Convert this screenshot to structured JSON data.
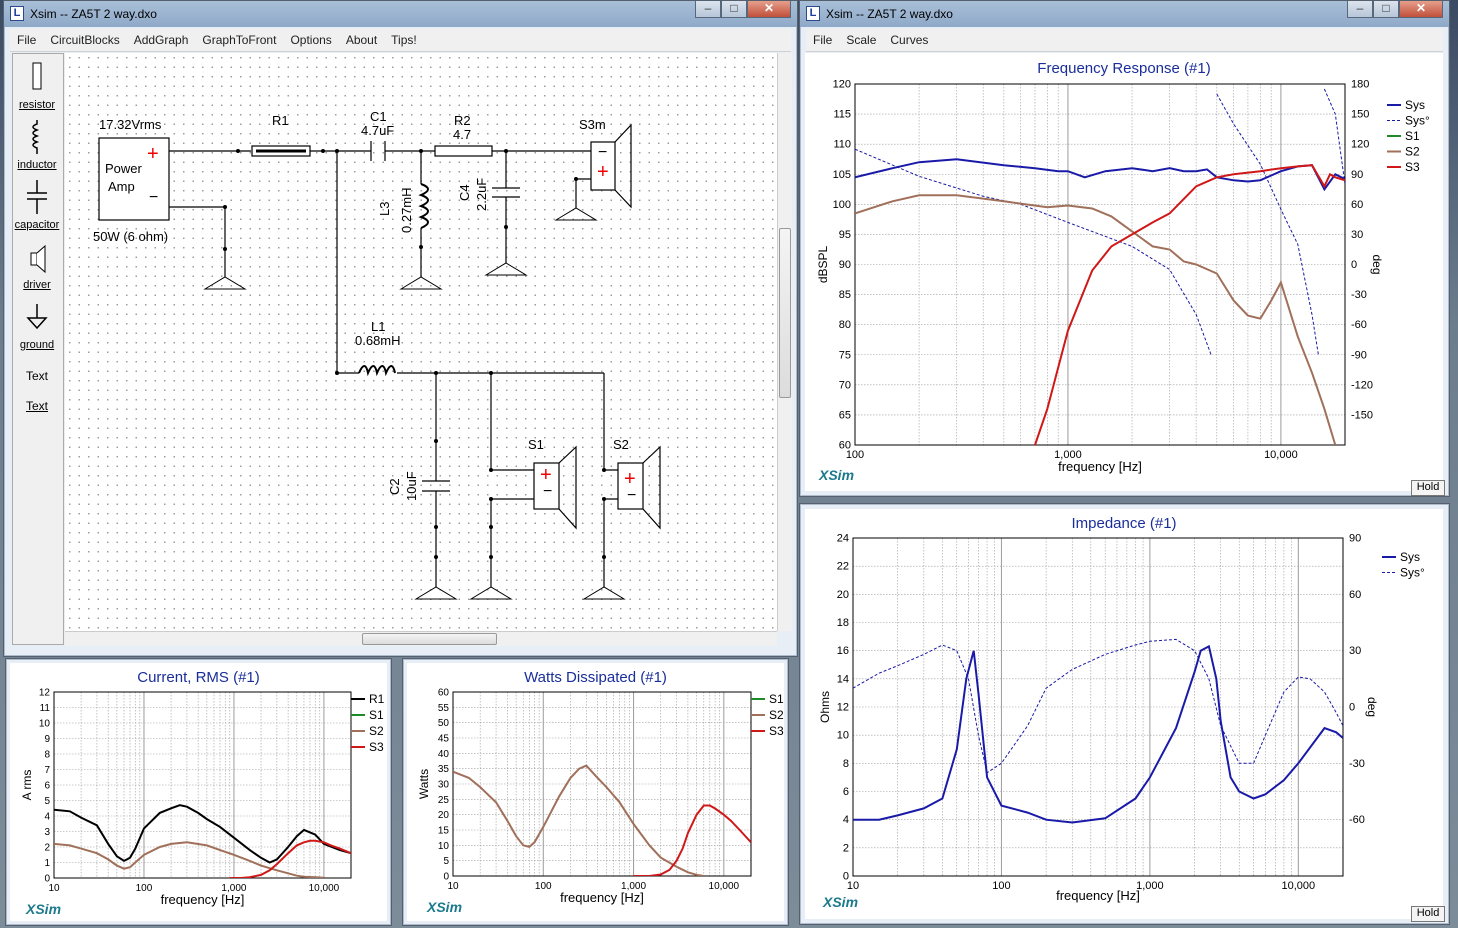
{
  "schematic_window": {
    "title": "Xsim -- ZA5T 2 way.dxo",
    "menu": [
      "File",
      "CircuitBlocks",
      "AddGraph",
      "GraphToFront",
      "Options",
      "About",
      "Tips!"
    ],
    "palette": [
      "resistor",
      "inductor",
      "capacitor",
      "driver",
      "ground",
      "Text",
      "Text"
    ],
    "components": {
      "voltage": "17.32Vrms",
      "amp_line1": "Power",
      "amp_line2": "Amp",
      "amp_rating": "50W (6 ohm)",
      "r1": "R1",
      "c1": "C1",
      "c1_val": "4.7uF",
      "r2": "R2",
      "r2_val": "4.7",
      "s3m": "S3m",
      "l3": "L3",
      "l3_val": "0.27mH",
      "c4": "C4",
      "c4_val": "2.2uF",
      "l1": "L1",
      "l1_val": "0.68mH",
      "c2": "C2",
      "c2_val": "10uF",
      "s1": "S1",
      "s2": "S2",
      "plus": "+",
      "minus": "−"
    }
  },
  "freq_window": {
    "title": "Xsim -- ZA5T 2 way.dxo",
    "menu": [
      "File",
      "Scale",
      "Curves"
    ],
    "graph_title": "Frequency Response (#1)",
    "ylabel": "dBSPL",
    "y2label": "deg",
    "xlabel": "frequency [Hz]",
    "xticks": [
      "100",
      "1,000",
      "10,000"
    ],
    "yticks": [
      "60",
      "65",
      "70",
      "75",
      "80",
      "85",
      "90",
      "95",
      "100",
      "105",
      "110",
      "115",
      "120"
    ],
    "y2ticks": [
      "-150",
      "-120",
      "-90",
      "-60",
      "-30",
      "0",
      "30",
      "60",
      "90",
      "120",
      "150",
      "180"
    ],
    "legend": [
      "Sys",
      "Sys°",
      "S1",
      "S2",
      "S3"
    ],
    "brand": "XSim",
    "hold": "Hold"
  },
  "impedance_window": {
    "graph_title": "Impedance (#1)",
    "ylabel": "Ohms",
    "y2label": "deg",
    "xlabel": "frequency [Hz]",
    "xticks": [
      "10",
      "100",
      "1,000",
      "10,000"
    ],
    "yticks": [
      "0",
      "2",
      "4",
      "6",
      "8",
      "10",
      "12",
      "14",
      "16",
      "18",
      "20",
      "22",
      "24"
    ],
    "y2ticks": [
      "-60",
      "-30",
      "0",
      "30",
      "60",
      "90"
    ],
    "legend": [
      "Sys",
      "Sys°"
    ],
    "brand": "XSim",
    "hold": "Hold"
  },
  "current_window": {
    "graph_title": "Current, RMS (#1)",
    "ylabel": "A rms",
    "xlabel": "frequency [Hz]",
    "xticks": [
      "10",
      "100",
      "1,000",
      "10,000"
    ],
    "yticks": [
      "0",
      "1",
      "2",
      "3",
      "4",
      "5",
      "6",
      "7",
      "8",
      "9",
      "10",
      "11",
      "12"
    ],
    "legend": [
      "R1",
      "S1",
      "S2",
      "S3"
    ],
    "brand": "XSim"
  },
  "watts_window": {
    "graph_title": "Watts Dissipated (#1)",
    "ylabel": "Watts",
    "xlabel": "frequency [Hz]",
    "xticks": [
      "10",
      "100",
      "1,000",
      "10,000"
    ],
    "yticks": [
      "0",
      "5",
      "10",
      "15",
      "20",
      "25",
      "30",
      "35",
      "40",
      "45",
      "50",
      "55",
      "60"
    ],
    "legend": [
      "S1",
      "S2",
      "S3"
    ],
    "brand": "XSim"
  },
  "colors": {
    "sys": "#1a1aa8",
    "s1": "#1e8a2a",
    "s2": "#a0705a",
    "s3": "#d01818",
    "r1": "#000000",
    "grid": "#9c9c9c",
    "title": "#1a2e9a"
  },
  "chart_data": [
    {
      "type": "line",
      "title": "Frequency Response (#1)",
      "xlabel": "frequency [Hz]",
      "ylabel": "dBSPL",
      "y2label": "deg",
      "xscale": "log",
      "xlim": [
        100,
        20000
      ],
      "ylim": [
        60,
        120
      ],
      "y2lim": [
        -180,
        180
      ],
      "legend_position": "top-right",
      "grid": true,
      "series": [
        {
          "name": "Sys",
          "axis": "y",
          "x": [
            100,
            150,
            200,
            300,
            500,
            700,
            900,
            1000,
            1200,
            1500,
            2000,
            2500,
            3000,
            3500,
            4000,
            4500,
            5000,
            6000,
            7000,
            8000,
            9000,
            10000,
            12000,
            14000,
            16000,
            18000,
            20000
          ],
          "y": [
            104.5,
            106,
            107,
            107.5,
            106.5,
            106,
            105.5,
            105.5,
            104.5,
            105.5,
            106,
            105.5,
            106,
            105.5,
            105.5,
            105.8,
            104.5,
            104,
            103.8,
            104,
            104.8,
            105.5,
            106.3,
            106.5,
            102.5,
            105,
            104.2
          ]
        },
        {
          "name": "Sys°",
          "axis": "y2",
          "x": [
            100,
            200,
            400,
            600,
            1000,
            1500,
            2000,
            3000,
            4000,
            4700,
            5000,
            6000,
            8000,
            10000,
            12000,
            14000,
            15000,
            16000,
            18000,
            20000
          ],
          "y": [
            115,
            88,
            68,
            60,
            42,
            28,
            18,
            -5,
            -50,
            -90,
            170,
            140,
            100,
            55,
            20,
            -50,
            -90,
            175,
            150,
            80
          ]
        },
        {
          "name": "S2",
          "axis": "y",
          "x": [
            100,
            150,
            200,
            300,
            500,
            800,
            1000,
            1300,
            1600,
            2000,
            2500,
            3000,
            3500,
            4000,
            5000,
            6000,
            7000,
            8000,
            9000,
            10000,
            12000,
            14000,
            16000,
            18000
          ],
          "y": [
            98.5,
            100.5,
            101.5,
            101.5,
            100.5,
            99.5,
            99.8,
            99.3,
            98,
            95.5,
            93,
            92.5,
            90.5,
            90,
            88.5,
            84,
            81.5,
            81,
            84,
            87,
            78,
            72,
            66,
            60
          ]
        },
        {
          "name": "S3",
          "axis": "y",
          "x": [
            700,
            800,
            1000,
            1300,
            1600,
            2000,
            2500,
            3000,
            4000,
            5000,
            6000,
            8000,
            10000,
            12000,
            14000,
            16000,
            17000,
            18000,
            20000
          ],
          "y": [
            60,
            66,
            79,
            89,
            93,
            95,
            97,
            98.5,
            103,
            104.5,
            105,
            105.5,
            106,
            106.3,
            106.5,
            103,
            105,
            104.5,
            104
          ]
        }
      ]
    },
    {
      "type": "line",
      "title": "Impedance (#1)",
      "xlabel": "frequency [Hz]",
      "ylabel": "Ohms",
      "y2label": "deg",
      "xscale": "log",
      "xlim": [
        10,
        20000
      ],
      "ylim": [
        0,
        24
      ],
      "y2lim": [
        -90,
        90
      ],
      "legend_position": "top-right",
      "grid": true,
      "series": [
        {
          "name": "Sys",
          "axis": "y",
          "x": [
            10,
            15,
            20,
            30,
            40,
            50,
            58,
            65,
            70,
            80,
            100,
            150,
            200,
            300,
            500,
            800,
            1000,
            1500,
            2000,
            2200,
            2500,
            2800,
            3000,
            3500,
            4000,
            5000,
            6000,
            8000,
            10000,
            15000,
            18000,
            20000
          ],
          "y": [
            4,
            4,
            4.3,
            4.8,
            5.5,
            9,
            14,
            16,
            13,
            7,
            5,
            4.5,
            4,
            3.8,
            4.1,
            5.5,
            7,
            10.5,
            14.5,
            16,
            16.3,
            14,
            11,
            7,
            6,
            5.5,
            5.8,
            6.8,
            8,
            10.5,
            10.2,
            9.8
          ]
        },
        {
          "name": "Sys°",
          "axis": "y2",
          "x": [
            10,
            15,
            20,
            30,
            40,
            50,
            60,
            70,
            80,
            100,
            150,
            200,
            300,
            500,
            800,
            1000,
            1500,
            2000,
            2500,
            3000,
            4000,
            5000,
            6000,
            8000,
            10000,
            12000,
            15000,
            18000,
            20000
          ],
          "y": [
            10,
            18,
            22,
            28,
            33,
            30,
            15,
            -15,
            -35,
            -30,
            -10,
            10,
            20,
            28,
            33,
            35,
            36,
            30,
            15,
            -10,
            -30,
            -30,
            -15,
            8,
            16,
            15,
            8,
            -3,
            -10
          ]
        }
      ]
    },
    {
      "type": "line",
      "title": "Current, RMS (#1)",
      "xlabel": "frequency [Hz]",
      "ylabel": "A rms",
      "xscale": "log",
      "xlim": [
        10,
        20000
      ],
      "ylim": [
        0,
        12
      ],
      "legend_position": "top-right",
      "grid": true,
      "series": [
        {
          "name": "R1",
          "x": [
            10,
            15,
            20,
            30,
            40,
            50,
            60,
            70,
            80,
            100,
            150,
            200,
            250,
            300,
            400,
            500,
            700,
            1000,
            1500,
            2000,
            2500,
            3000,
            4000,
            5000,
            6000,
            8000,
            10000,
            15000,
            20000
          ],
          "y": [
            4.4,
            4.3,
            3.9,
            3.4,
            2.2,
            1.4,
            1.1,
            1.3,
            1.9,
            3.2,
            4.2,
            4.5,
            4.7,
            4.6,
            4.2,
            3.8,
            3.3,
            2.6,
            1.8,
            1.3,
            1.0,
            1.2,
            2.0,
            2.7,
            3.1,
            2.8,
            2.2,
            1.8,
            1.6
          ]
        },
        {
          "name": "S2",
          "x": [
            10,
            15,
            20,
            30,
            40,
            50,
            60,
            70,
            80,
            100,
            150,
            200,
            300,
            500,
            700,
            1000,
            1500,
            2000,
            3000,
            4000,
            5000,
            6000,
            8000,
            10000
          ],
          "y": [
            2.2,
            2.1,
            1.9,
            1.6,
            1.2,
            0.8,
            0.6,
            0.7,
            1.0,
            1.5,
            2.0,
            2.2,
            2.3,
            2.1,
            1.8,
            1.5,
            1.1,
            0.8,
            0.5,
            0.3,
            0.15,
            0.08,
            0.05,
            0.02
          ]
        },
        {
          "name": "S3",
          "x": [
            900,
            1200,
            1500,
            2000,
            2500,
            3000,
            4000,
            5000,
            6000,
            7000,
            8000,
            10000,
            12000,
            15000,
            20000
          ],
          "y": [
            0,
            0,
            0.05,
            0.2,
            0.5,
            0.9,
            1.6,
            2.1,
            2.3,
            2.4,
            2.4,
            2.3,
            2.1,
            1.9,
            1.6
          ]
        }
      ]
    },
    {
      "type": "line",
      "title": "Watts Dissipated (#1)",
      "xlabel": "frequency [Hz]",
      "ylabel": "Watts",
      "xscale": "log",
      "xlim": [
        10,
        20000
      ],
      "ylim": [
        0,
        60
      ],
      "legend_position": "top-right",
      "grid": true,
      "series": [
        {
          "name": "S2",
          "x": [
            10,
            15,
            20,
            30,
            40,
            50,
            60,
            70,
            80,
            100,
            150,
            200,
            250,
            300,
            400,
            500,
            700,
            1000,
            1500,
            2000,
            3000,
            4000,
            5000,
            6000
          ],
          "y": [
            34,
            32,
            29,
            24,
            18,
            13,
            10,
            9.5,
            11,
            16,
            26,
            32,
            35,
            36,
            32,
            29,
            24,
            17,
            10,
            6,
            3,
            1.2,
            0.4,
            0
          ]
        },
        {
          "name": "S3",
          "x": [
            1000,
            1500,
            2000,
            2500,
            3000,
            3500,
            4000,
            5000,
            6000,
            7000,
            8000,
            10000,
            12000,
            15000,
            20000
          ],
          "y": [
            0,
            0,
            0.5,
            2,
            5,
            9,
            14,
            20,
            23,
            23,
            22,
            20,
            18,
            15,
            11
          ]
        }
      ]
    }
  ]
}
